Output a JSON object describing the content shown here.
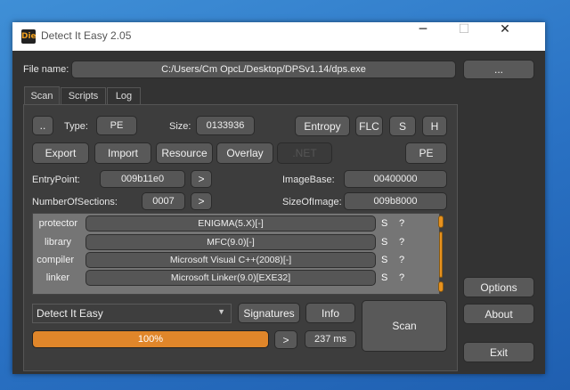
{
  "window": {
    "title": "Detect It Easy 2.05",
    "icon_text": "Die",
    "controls": {
      "minimize": "─",
      "maximize": "☐",
      "close": "✕"
    }
  },
  "file": {
    "label": "File name:",
    "path": "C:/Users/Cm OpcL/Desktop/DPSv1.14/dps.exe",
    "browse_label": "..."
  },
  "tabs": [
    {
      "label": "Scan",
      "active": true
    },
    {
      "label": "Scripts",
      "active": false
    },
    {
      "label": "Log",
      "active": false
    }
  ],
  "scan": {
    "dots_label": "..",
    "type_label": "Type:",
    "type_value": "PE",
    "size_label": "Size:",
    "size_value": "0133936",
    "entropy_label": "Entropy",
    "flc_label": "FLC",
    "s_label": "S",
    "h_label": "H",
    "export_label": "Export",
    "import_label": "Import",
    "resource_label": "Resource",
    "overlay_label": "Overlay",
    "net_label": ".NET",
    "pe_label": "PE",
    "entrypoint_label": "EntryPoint:",
    "entrypoint_value": "009b11e0",
    "imagebase_label": "ImageBase:",
    "imagebase_value": "00400000",
    "sections_label": "NumberOfSections:",
    "sections_value": "0007",
    "sizeofimage_label": "SizeOfImage:",
    "sizeofimage_value": "009b8000",
    "arrow_label": ">"
  },
  "detections": [
    {
      "type": "protector",
      "name": "ENIGMA(5.X)[-]",
      "s": "S",
      "q": "?"
    },
    {
      "type": "library",
      "name": "MFC(9.0)[-]",
      "s": "S",
      "q": "?"
    },
    {
      "type": "compiler",
      "name": "Microsoft Visual C++(2008)[-]",
      "s": "S",
      "q": "?"
    },
    {
      "type": "linker",
      "name": "Microsoft Linker(9.0)[EXE32]",
      "s": "S",
      "q": "?"
    }
  ],
  "bottom": {
    "database": "Detect It Easy",
    "signatures_label": "Signatures",
    "info_label": "Info",
    "scan_label": "Scan",
    "progress_text": "100%",
    "progress_value": 1.0,
    "arrow_label": ">",
    "time": "237 ms"
  },
  "side": {
    "options_label": "Options",
    "about_label": "About",
    "exit_label": "Exit"
  },
  "colors": {
    "accent": "#e0862a",
    "window_bg": "#333333"
  }
}
